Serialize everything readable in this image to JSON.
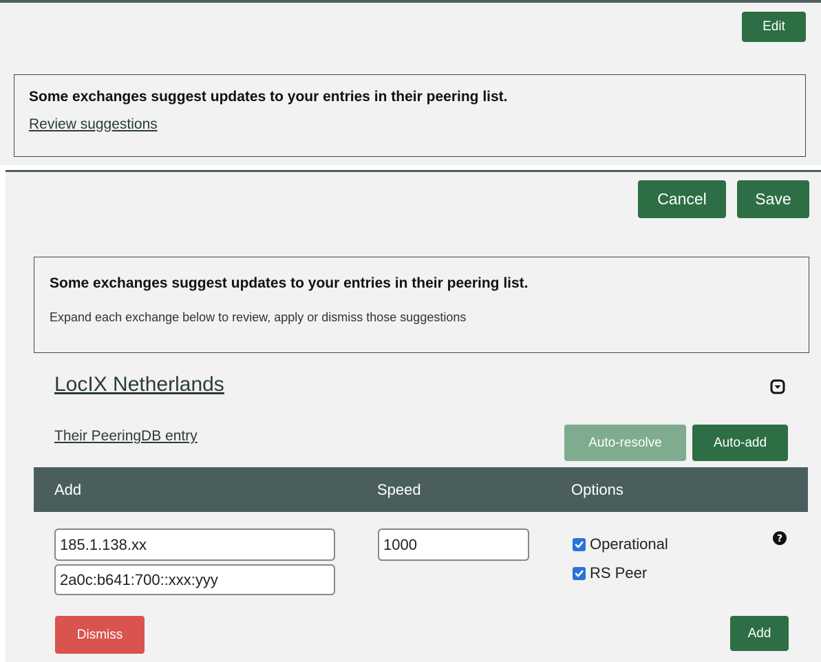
{
  "top_panel": {
    "edit_label": "Edit",
    "notice": {
      "title": "Some exchanges suggest updates to your entries in their peering list.",
      "link": "Review suggestions"
    }
  },
  "edit_panel": {
    "cancel_label": "Cancel",
    "save_label": "Save",
    "notice": {
      "title": "Some exchanges suggest updates to your entries in their peering list.",
      "subtitle": "Expand each exchange below to review, apply or dismiss those suggestions"
    },
    "exchange": {
      "name": "LocIX Netherlands",
      "peeringdb_link": "Their PeeringDB entry",
      "auto_resolve_label": "Auto-resolve",
      "auto_add_label": "Auto-add",
      "columns": [
        "Add",
        "Speed",
        "Options"
      ],
      "row": {
        "ipv4": "185.1.138.xx",
        "ipv6": "2a0c:b641:700::xxx:yyy",
        "speed": "1000",
        "options": [
          {
            "label": "Operational",
            "checked": true
          },
          {
            "label": "RS Peer",
            "checked": true
          }
        ]
      },
      "dismiss_label": "Dismiss",
      "add_label": "Add"
    }
  },
  "colors": {
    "primary_green": "#2e6e45",
    "disabled_green": "#7fac8e",
    "danger_red": "#d9534f",
    "header_slate": "#4a5e5e",
    "checkbox_blue": "#2b73d4"
  }
}
